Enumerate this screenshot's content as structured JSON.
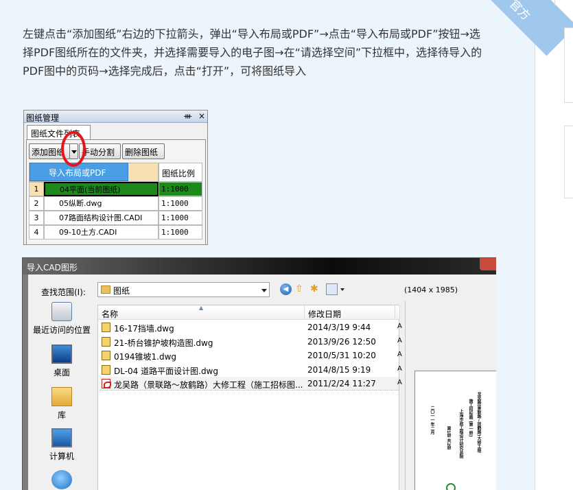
{
  "ribbon": {
    "text": "官方"
  },
  "article": {
    "instructions": "左键点击“添加图纸”右边的下拉箭头，弹出“导入布局或PDF”→点击“导入布局或PDF”按钮→选择PDF图纸所在的文件夹，并选择需要导入的电子图→在“请选择空间”下拉框中，选择待导入的PDF图中的页码→选择完成后，点击“打开”，可将图纸导入"
  },
  "drawing_manager": {
    "title": "图纸管理",
    "pin_icon": "pin-icon",
    "close_glyph": "×",
    "tab_label": "图纸文件列表",
    "buttons": {
      "add": "添加图纸",
      "manual_split": "手动分割",
      "delete": "删除图纸"
    },
    "dropdown_item": "导入布局或PDF",
    "scale_header": "图纸比例",
    "highlight_color": "#1b8a1b",
    "annotation_color": "#e8141c",
    "rows": [
      {
        "num": "1",
        "name": "04平面(当前图纸)",
        "scale": "1:1000"
      },
      {
        "num": "2",
        "name": "05纵断.dwg",
        "scale": "1:1000"
      },
      {
        "num": "3",
        "name": "07路面结构设计图.CADI",
        "scale": "1:1000"
      },
      {
        "num": "4",
        "name": "09-10土方.CADI",
        "scale": "1:1000"
      }
    ]
  },
  "import_dialog": {
    "title": "导入CAD图形",
    "look_in_label": "查找范围(I):",
    "look_in_value": "图纸",
    "toolbar_icons": [
      "back-icon",
      "up-folder-icon",
      "new-folder-icon",
      "view-menu-icon"
    ],
    "preview_size": "(1404 x 1985)",
    "places": [
      {
        "label": "最近访问的位置",
        "icon": "recent-places-icon"
      },
      {
        "label": "桌面",
        "icon": "desktop-icon"
      },
      {
        "label": "库",
        "icon": "library-icon"
      },
      {
        "label": "计算机",
        "icon": "computer-icon"
      },
      {
        "label": "",
        "icon": "network-icon"
      }
    ],
    "columns": {
      "name": "名称",
      "date": "修改日期"
    },
    "files": [
      {
        "name": "16-17挡墙.dwg",
        "date": "2014/3/19 9:44",
        "type": "dwg"
      },
      {
        "name": "21-桥台锥护坡构造图.dwg",
        "date": "2013/9/26 12:50",
        "type": "dwg"
      },
      {
        "name": "0194锥坡1.dwg",
        "date": "2010/5/31 10:20",
        "type": "dwg"
      },
      {
        "name": "DL-04 道路平面设计图.dwg",
        "date": "2014/8/15 9:19",
        "type": "dwg"
      },
      {
        "name": "龙吴路（景联路～放鹤路）大修工程（施工招标图...",
        "date": "2011/2/24 11:27",
        "type": "pdf"
      }
    ],
    "truncated_col_marker": "A",
    "preview_lines": [
      "龙吴路(景联路~放鹤路)大修工程",
      "施工招标图 (第一册)",
      "上海市政工程设计研究总院",
      "第1册 共2册",
      "二〇一一年二月"
    ]
  }
}
